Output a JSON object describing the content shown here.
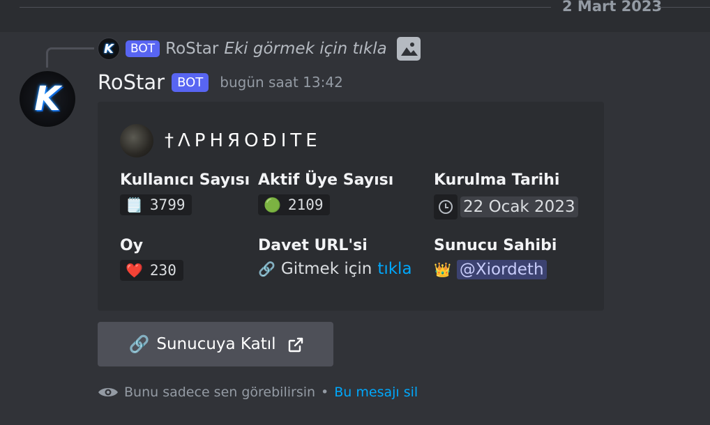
{
  "divider": {
    "date": "2 Mart 2023"
  },
  "reply": {
    "avatar_letter": "K",
    "bot_tag": "BOT",
    "name": "RoStar",
    "text": "Eki görmek için tıkla",
    "attachment_icon": "image-icon"
  },
  "message": {
    "avatar_letter": "K",
    "author": "RoStar",
    "bot_tag": "BOT",
    "timestamp": "bugün saat 13:42"
  },
  "embed": {
    "author_name": "†ΛPHЯOĐITE",
    "fields": {
      "users": {
        "name": "Kullanıcı Sayısı",
        "emoji": "🗒️",
        "value": "3799"
      },
      "active": {
        "name": "Aktif Üye Sayısı",
        "emoji": "🟢",
        "value": "2109"
      },
      "created": {
        "name": "Kurulma Tarihi",
        "icon": "clock-icon",
        "value": "22 Ocak 2023"
      },
      "votes": {
        "name": "Oy",
        "emoji": "❤️",
        "value": "230"
      },
      "invite": {
        "name": "Davet URL'si",
        "emoji": "🔗",
        "text": "Gitmek için",
        "link": "tıkla"
      },
      "owner": {
        "name": "Sunucu Sahibi",
        "emoji": "👑",
        "mention": "@Xiordeth"
      }
    }
  },
  "join_button": {
    "emoji": "🔗",
    "label": "Sunucuya Katıl",
    "icon": "external-link-icon"
  },
  "ephemeral": {
    "icon": "eye-icon",
    "text": "Bunu sadece sen görebilirsin",
    "separator": "•",
    "dismiss": "Bu mesajı sil"
  },
  "colors": {
    "background": "#313338",
    "embed": "#2b2d31",
    "bot_tag": "#5865f2",
    "link": "#00a8fc",
    "mention_bg": "#3c4270"
  }
}
